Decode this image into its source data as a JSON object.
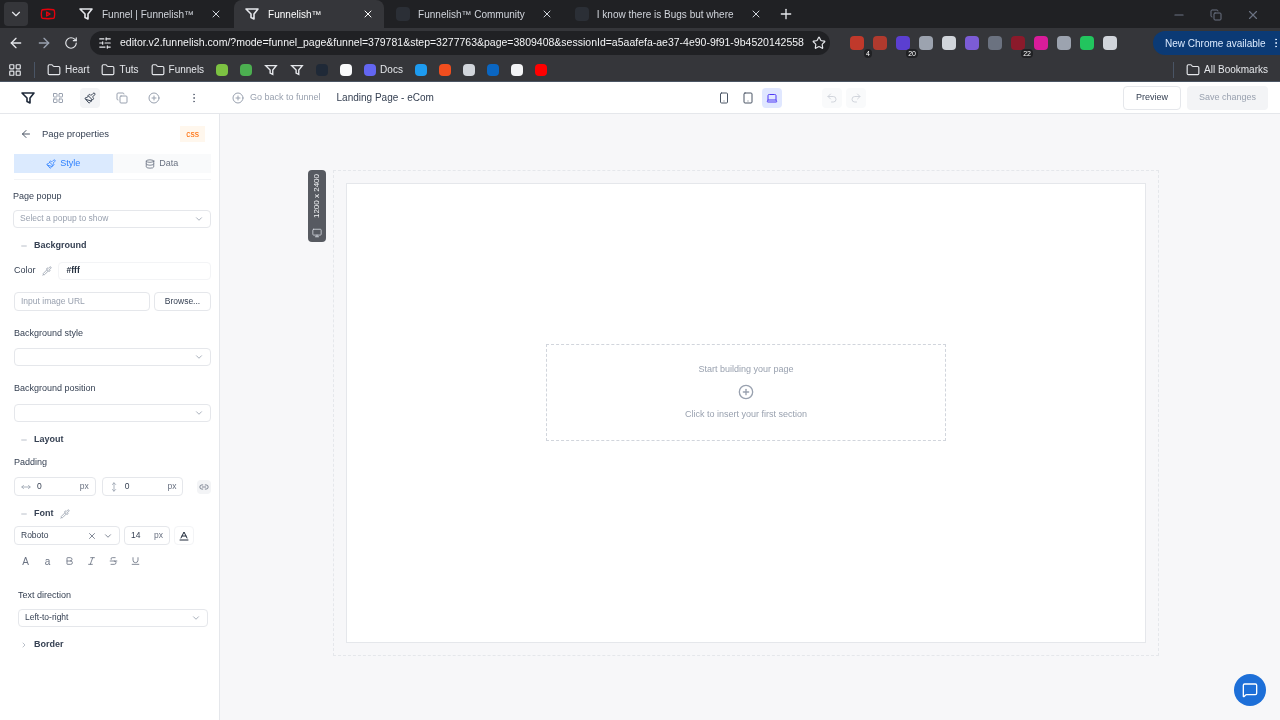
{
  "browser": {
    "tabs": [
      {
        "kind": "youtube",
        "selected": false
      },
      {
        "kind": "funnel",
        "title": "Funnel | Funnelish™",
        "selected": false
      },
      {
        "kind": "funnel",
        "title": "Funnelish™",
        "selected": true
      },
      {
        "kind": "community",
        "title": "Funnelish™ Community",
        "selected": false
      },
      {
        "kind": "community",
        "title": "I know there is Bugs but where",
        "selected": false
      }
    ],
    "address": "editor.v2.funnelish.com/?mode=funnel_page&funnel=379781&step=3277763&page=3809408&sessionId=a5aafefa-ae37-4e90-9f91-9b4520142558",
    "extensions": [
      {
        "color": "#c0392b",
        "badge": "4"
      },
      {
        "color": "#b03a2e"
      },
      {
        "color": "#5b3fd1",
        "badge": "20"
      },
      {
        "color": "#9ca3af"
      },
      {
        "color": "#d1d5db"
      },
      {
        "color": "#7c5cd6"
      },
      {
        "color": "#6b7280"
      },
      {
        "color": "#8b1a2b",
        "badge": "22"
      },
      {
        "color": "#d91c9a"
      },
      {
        "color": "#9ca3af"
      },
      {
        "color": "#22c55e"
      },
      {
        "color": "#d1d5db"
      }
    ],
    "update_button": "New Chrome available",
    "bookmarks": [
      {
        "kind": "folder",
        "label": "Heart"
      },
      {
        "kind": "folder",
        "label": "Tuts"
      },
      {
        "kind": "folder",
        "label": "Funnels"
      },
      {
        "kind": "site",
        "color": "#7cc242"
      },
      {
        "kind": "site",
        "color": "#4caf50"
      },
      {
        "kind": "funnel",
        "color": "#e5e7eb"
      },
      {
        "kind": "funnel",
        "color": "#e5e7eb"
      },
      {
        "kind": "site",
        "color": "#1f2937"
      },
      {
        "kind": "site",
        "color": "#f9fafb"
      },
      {
        "kind": "site",
        "color": "#6366f1",
        "label": "Docs"
      },
      {
        "kind": "site",
        "color": "#1d9bf0"
      },
      {
        "kind": "site",
        "color": "#f24e1e"
      },
      {
        "kind": "site",
        "color": "#d1d5db"
      },
      {
        "kind": "site",
        "color": "#0a66c2"
      },
      {
        "kind": "site",
        "color": "#f3f4f6"
      },
      {
        "kind": "site",
        "color": "#ff0000"
      }
    ],
    "all_bookmarks": "All Bookmarks"
  },
  "editor": {
    "tools": [
      {
        "kind": "grid",
        "selected": false
      },
      {
        "kind": "brush",
        "selected": true
      },
      {
        "kind": "copy",
        "selected": false
      },
      {
        "kind": "add",
        "selected": false
      }
    ],
    "back_link": "Go back to funnel",
    "page_title": "Landing Page - eCom",
    "devices": [
      {
        "kind": "phone",
        "selected": false
      },
      {
        "kind": "tablet",
        "selected": false
      },
      {
        "kind": "desktop",
        "selected": true
      }
    ],
    "undo": {
      "disabled": true
    },
    "redo": {
      "disabled": true
    },
    "preview": "Preview",
    "save": {
      "label": "Save changes",
      "disabled": true
    }
  },
  "panel": {
    "title": "Page properties",
    "css": "css",
    "tabs": [
      {
        "kind": "style",
        "label": "Style",
        "selected": true
      },
      {
        "kind": "data",
        "label": "Data",
        "selected": false
      }
    ],
    "page_popup": {
      "label": "Page popup",
      "placeholder": "Select a popup to show"
    },
    "background": {
      "title": "Background",
      "expanded": true,
      "color_label": "Color",
      "color_value": "#fff",
      "image_placeholder": "Input image URL",
      "browse": "Browse...",
      "style_label": "Background style",
      "position_label": "Background position"
    },
    "layout": {
      "title": "Layout",
      "expanded": true,
      "padding_label": "Padding",
      "padding": [
        {
          "kind": "horizontal",
          "value": "0",
          "unit": "px"
        },
        {
          "kind": "vertical",
          "value": "0",
          "unit": "px"
        }
      ]
    },
    "font": {
      "title": "Font",
      "expanded": true,
      "family": "Roboto",
      "size": "14",
      "unit": "px",
      "styles": [
        {
          "kind": "text",
          "label": "A"
        },
        {
          "kind": "text",
          "label": "a"
        },
        {
          "kind": "bold"
        },
        {
          "kind": "italic"
        },
        {
          "kind": "strike"
        },
        {
          "kind": "underline"
        }
      ]
    },
    "text_direction": {
      "label": "Text direction",
      "value": "Left-to-right"
    },
    "border": {
      "title": "Border",
      "expanded": false
    }
  },
  "canvas": {
    "size": "1200 x 2400",
    "empty_title": "Start building your page",
    "empty_hint": "Click to insert your first section"
  }
}
